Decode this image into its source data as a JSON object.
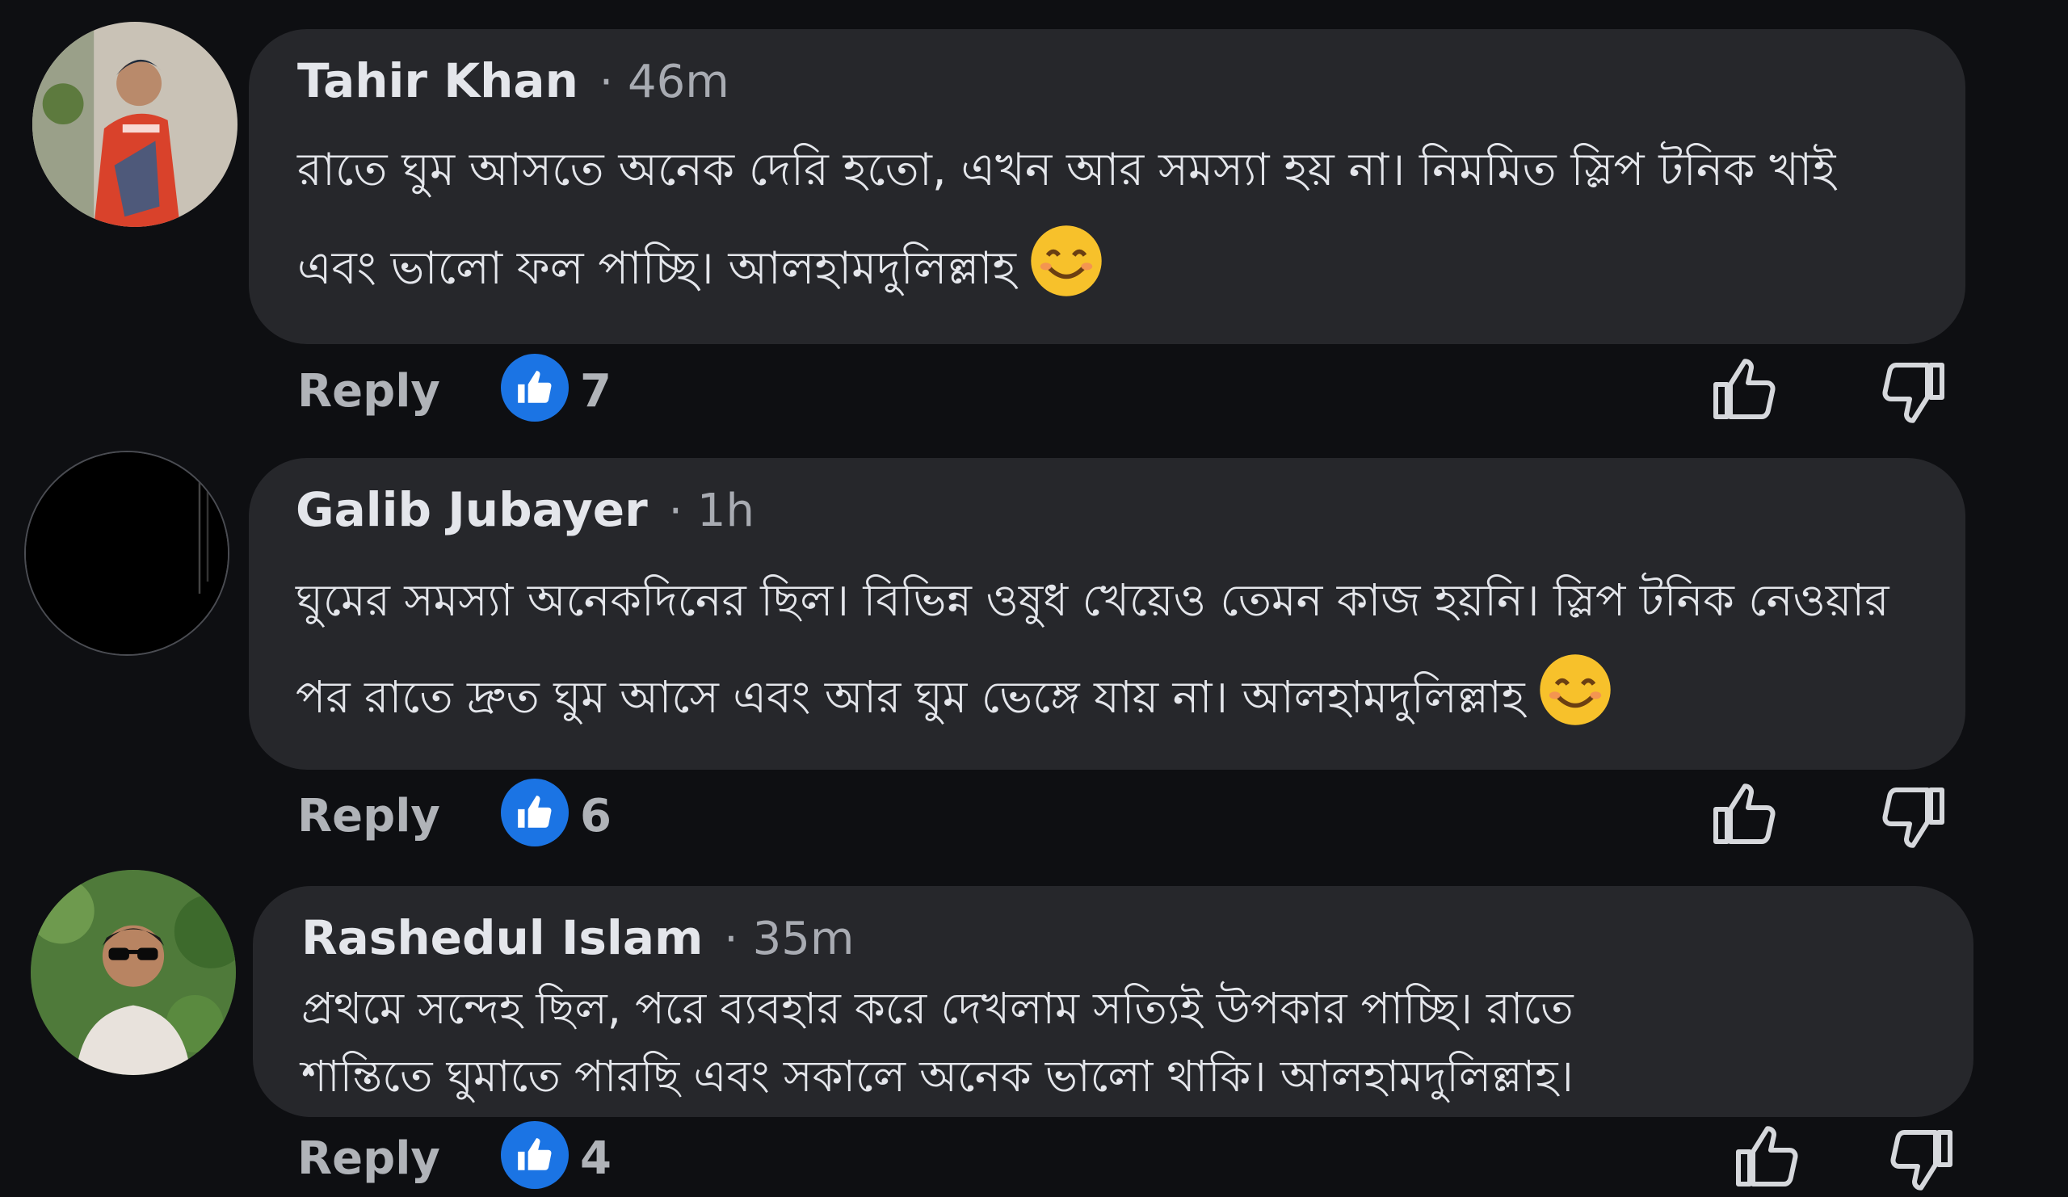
{
  "comments": [
    {
      "author": "Tahir Khan",
      "time": "46m",
      "text": "রাতে ঘুম আসতে অনেক দেরি হতো, এখন আর সমস্যা হয় না। নিমমিত স্লিপ টনিক খাই এবং ভালো ফল পাচ্ছি। আলহামদুলিল্লাহ",
      "emoji": "smiling-face-icon",
      "reply_label": "Reply",
      "likes": "7"
    },
    {
      "author": "Galib Jubayer",
      "time": "1h",
      "text": "ঘুমের সমস্যা অনেকদিনের ছিল। বিভিন্ন ওষুধ খেয়েও তেমন কাজ হয়নি। স্লিপ টনিক নেওয়ার পর রাতে দ্রুত ঘুম আসে এবং আর ঘুম ভেঙ্গে যায় না। আলহামদুলিল্লাহ",
      "emoji": "smiling-face-icon",
      "reply_label": "Reply",
      "likes": "6"
    },
    {
      "author": "Rashedul Islam",
      "time": "35m",
      "text": "প্রথমে সন্দেহ ছিল, পরে ব্যবহার করে দেখলাম সত্যিই উপকার পাচ্ছি। রাতে শান্তিতে ঘুমাতে পারছি এবং সকালে অনেক ভালো থাকি। আলহামদুলিল্লাহ।",
      "reply_label": "Reply",
      "likes": "4"
    }
  ],
  "colors": {
    "background": "#0e0f12",
    "bubble": "#26272b",
    "like_badge": "#1b74e4",
    "muted_text": "#b0b3b8"
  }
}
